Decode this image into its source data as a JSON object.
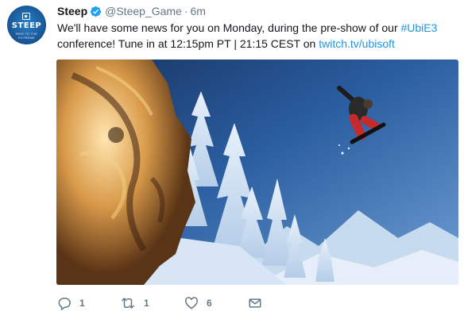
{
  "tweet": {
    "account": {
      "display_name": "Steep",
      "handle": "@Steep_Game",
      "verified_icon": "verified-badge-icon",
      "avatar": {
        "wordmark": "STEEP",
        "tagline": "RIDE TO THE EXTREME",
        "brand_color": "#1a5d9e"
      }
    },
    "separator": "·",
    "time": "6m",
    "body": {
      "part1": "We'll have some news for you on Monday, during the pre-show of our ",
      "hashtag": "#UbiE3",
      "part2": " conference! Tune in at 12:15pm PT | 21:15 CEST on ",
      "link": "twitch.tv/ubisoft"
    },
    "media": {
      "type": "image",
      "description_icon": "snowboard-photo"
    },
    "actions": {
      "reply": {
        "icon": "reply-icon",
        "count": "1"
      },
      "retweet": {
        "icon": "retweet-icon",
        "count": "1"
      },
      "like": {
        "icon": "heart-icon",
        "count": "6"
      },
      "message": {
        "icon": "envelope-icon"
      }
    },
    "colors": {
      "link": "#1b95e0",
      "text": "#14171a",
      "secondary": "#657786"
    }
  }
}
